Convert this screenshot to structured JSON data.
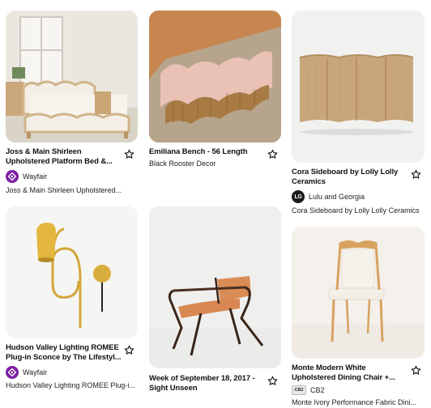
{
  "pins": [
    {
      "title": "Joss & Main Shirleen Upholstered Platform Bed &...",
      "source_name": "Wayfair",
      "source_icon": "wayfair-logo-icon",
      "description": "Joss & Main Shirleen Upholstered..."
    },
    {
      "title": "Emiliana Bench - 56 Length",
      "subtitle": "Black Rooster Decor"
    },
    {
      "title": "Cora Sideboard by Lolly Lolly Ceramics",
      "source_name": "Lulu and Georgia",
      "source_initials": "LG",
      "description": "Cora Sideboard by Lolly Lolly Ceramics"
    },
    {
      "title": "Hudson Valley Lighting ROMEE Plug-in Sconce by The Lifestyl...",
      "source_name": "Wayfair",
      "source_icon": "wayfair-logo-icon",
      "description": "Hudson Valley Lighting ROMEE Plug-i..."
    },
    {
      "title": "Week of September 18, 2017 - Sight Unseen"
    },
    {
      "title": "Monte Modern White Upholstered Dining Chair +...",
      "source_name": "CB2",
      "source_initials": "CB2",
      "description": "Monte Ivory Performance Fabric Dini..."
    }
  ],
  "colors": {
    "wayfair": "#7b1fa2",
    "lulu": "#1a1a1a"
  }
}
